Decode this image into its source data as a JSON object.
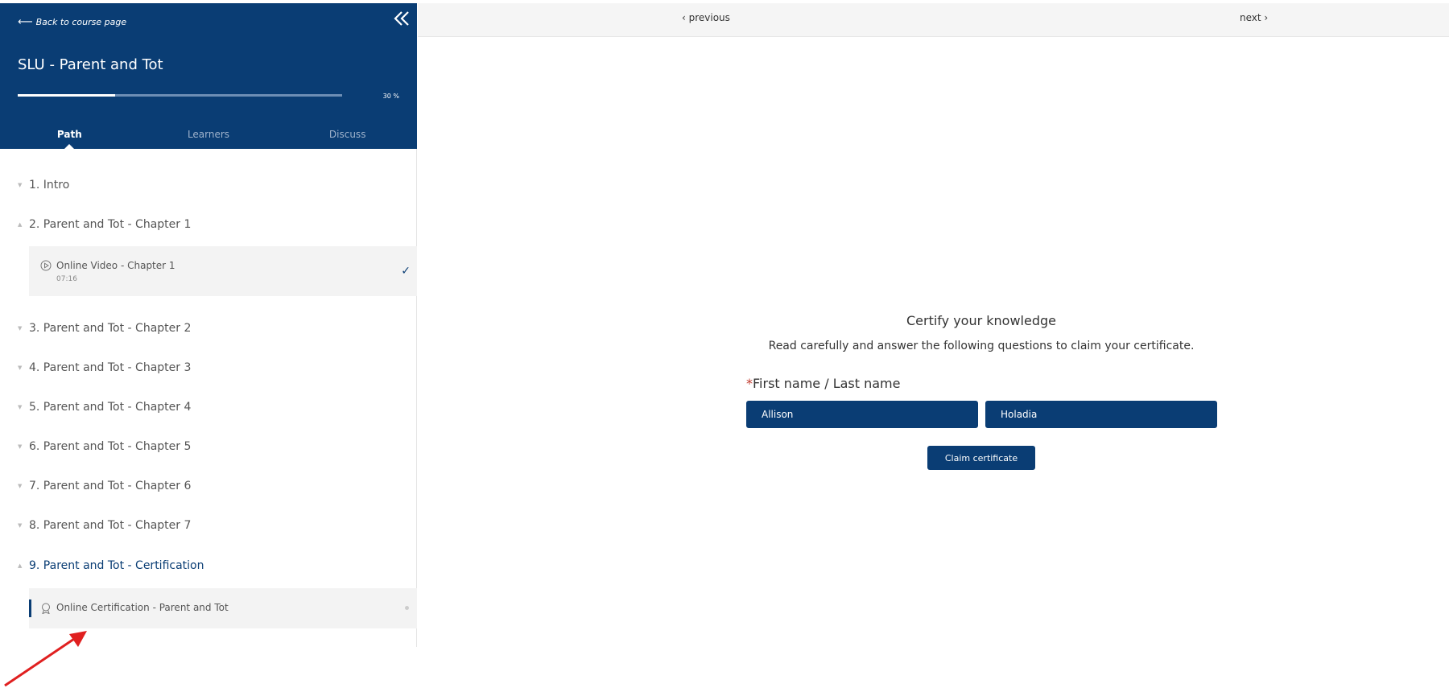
{
  "sidebar": {
    "back_label": "Back to course page",
    "course_title": "SLU - Parent and Tot",
    "progress_value": 0.3,
    "progress_label": "30 %",
    "tabs": [
      {
        "label": "Path"
      },
      {
        "label": "Learners"
      },
      {
        "label": "Discuss"
      }
    ],
    "chapters": [
      {
        "label": "1. Intro"
      },
      {
        "label": "2. Parent and Tot - Chapter 1"
      },
      {
        "label": "3. Parent and Tot - Chapter 2"
      },
      {
        "label": "4. Parent and Tot - Chapter 3"
      },
      {
        "label": "5. Parent and Tot - Chapter 4"
      },
      {
        "label": "6. Parent and Tot - Chapter 5"
      },
      {
        "label": "7. Parent and Tot - Chapter 6"
      },
      {
        "label": "8. Parent and Tot - Chapter 7"
      },
      {
        "label": "9. Parent and Tot - Certification"
      }
    ],
    "lessons": [
      {
        "title": "Online Video - Chapter 1",
        "duration": "07:16",
        "icon": "play-circle-icon",
        "status": "completed"
      },
      {
        "title": "Online Certification - Parent and Tot",
        "icon": "certificate-icon",
        "status": "current"
      }
    ]
  },
  "nav": {
    "previous_label": "‹ previous",
    "next_label": "next ›"
  },
  "main": {
    "cert_title": "Certify your knowledge",
    "cert_subtitle": "Read carefully and answer the following questions to claim your certificate.",
    "required_marker": "*",
    "name_label": "First name / Last name",
    "first_name_value": "Allison",
    "last_name_value": "Holadia",
    "claim_button_label": "Claim certificate"
  },
  "colors": {
    "brand_navy": "#0a3d74",
    "annotation_red": "#e02020"
  }
}
